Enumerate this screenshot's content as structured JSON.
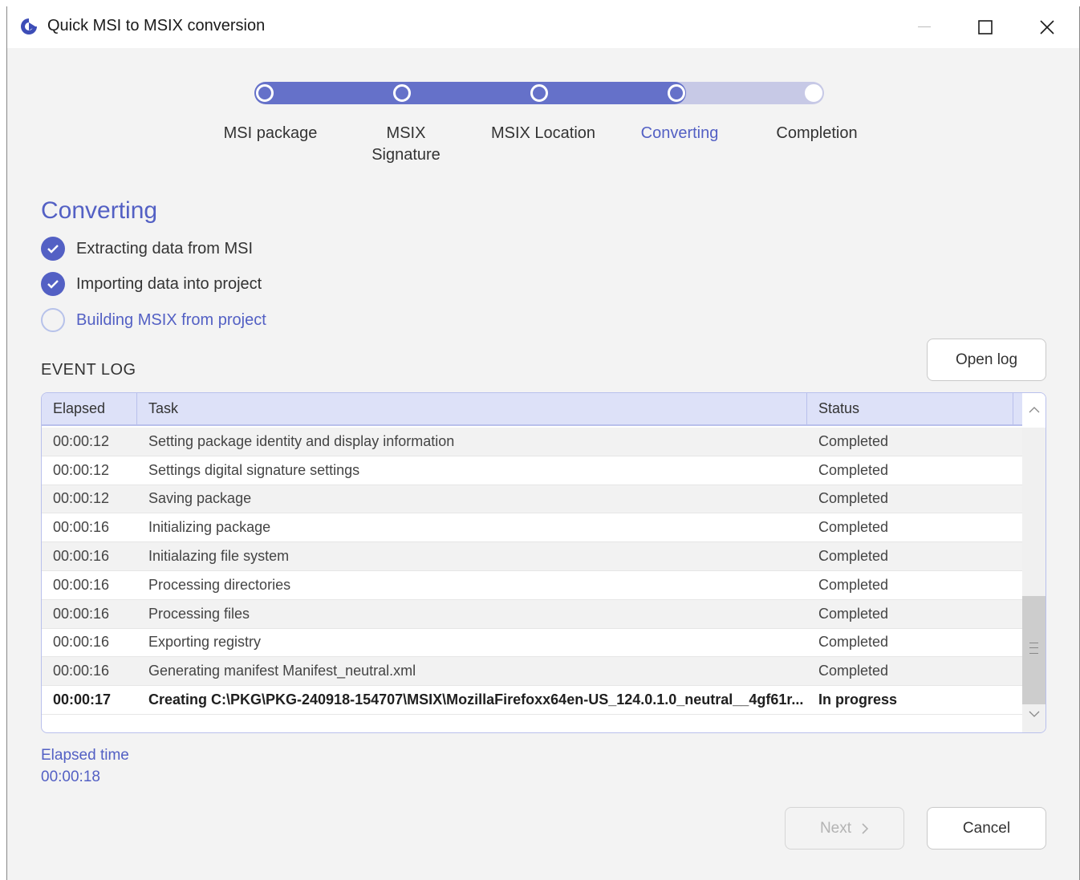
{
  "window": {
    "title": "Quick MSI to MSIX conversion"
  },
  "stepper": {
    "steps": [
      {
        "label": "MSI package"
      },
      {
        "label": "MSIX\nSignature"
      },
      {
        "label": "MSIX Location"
      },
      {
        "label": "Converting"
      },
      {
        "label": "Completion"
      }
    ],
    "active_step": "Converting"
  },
  "section": {
    "title": "Converting"
  },
  "tasks": [
    {
      "label": "Extracting data from MSI",
      "state": "done"
    },
    {
      "label": "Importing data into project",
      "state": "done"
    },
    {
      "label": "Building MSIX from project",
      "state": "pending"
    }
  ],
  "event_log": {
    "label": "EVENT LOG",
    "open_log_label": "Open log",
    "columns": [
      "Elapsed",
      "Task",
      "Status"
    ],
    "rows": [
      {
        "elapsed": "00:00:12",
        "task": "Setting package identity and display information",
        "status": "Completed"
      },
      {
        "elapsed": "00:00:12",
        "task": "Settings digital signature settings",
        "status": "Completed"
      },
      {
        "elapsed": "00:00:12",
        "task": "Saving package",
        "status": "Completed"
      },
      {
        "elapsed": "00:00:16",
        "task": "Initializing package",
        "status": "Completed"
      },
      {
        "elapsed": "00:00:16",
        "task": "Initialazing file system",
        "status": "Completed"
      },
      {
        "elapsed": "00:00:16",
        "task": "Processing directories",
        "status": "Completed"
      },
      {
        "elapsed": "00:00:16",
        "task": "Processing files",
        "status": "Completed"
      },
      {
        "elapsed": "00:00:16",
        "task": "Exporting registry",
        "status": "Completed"
      },
      {
        "elapsed": "00:00:16",
        "task": "Generating manifest Manifest_neutral.xml",
        "status": "Completed"
      },
      {
        "elapsed": "00:00:17",
        "task": "Creating C:\\PKG\\PKG-240918-154707\\MSIX\\MozillaFirefoxx64en-US_124.0.1.0_neutral__4gf61r...",
        "status": "In progress"
      }
    ]
  },
  "elapsed": {
    "label": "Elapsed time",
    "value": "00:00:18"
  },
  "footer": {
    "next_label": "Next",
    "cancel_label": "Cancel"
  },
  "colors": {
    "accent": "#5360c4",
    "track_done": "#6571c9",
    "track_todo": "#c7c9e6",
    "header_bg": "#dde1f8"
  }
}
